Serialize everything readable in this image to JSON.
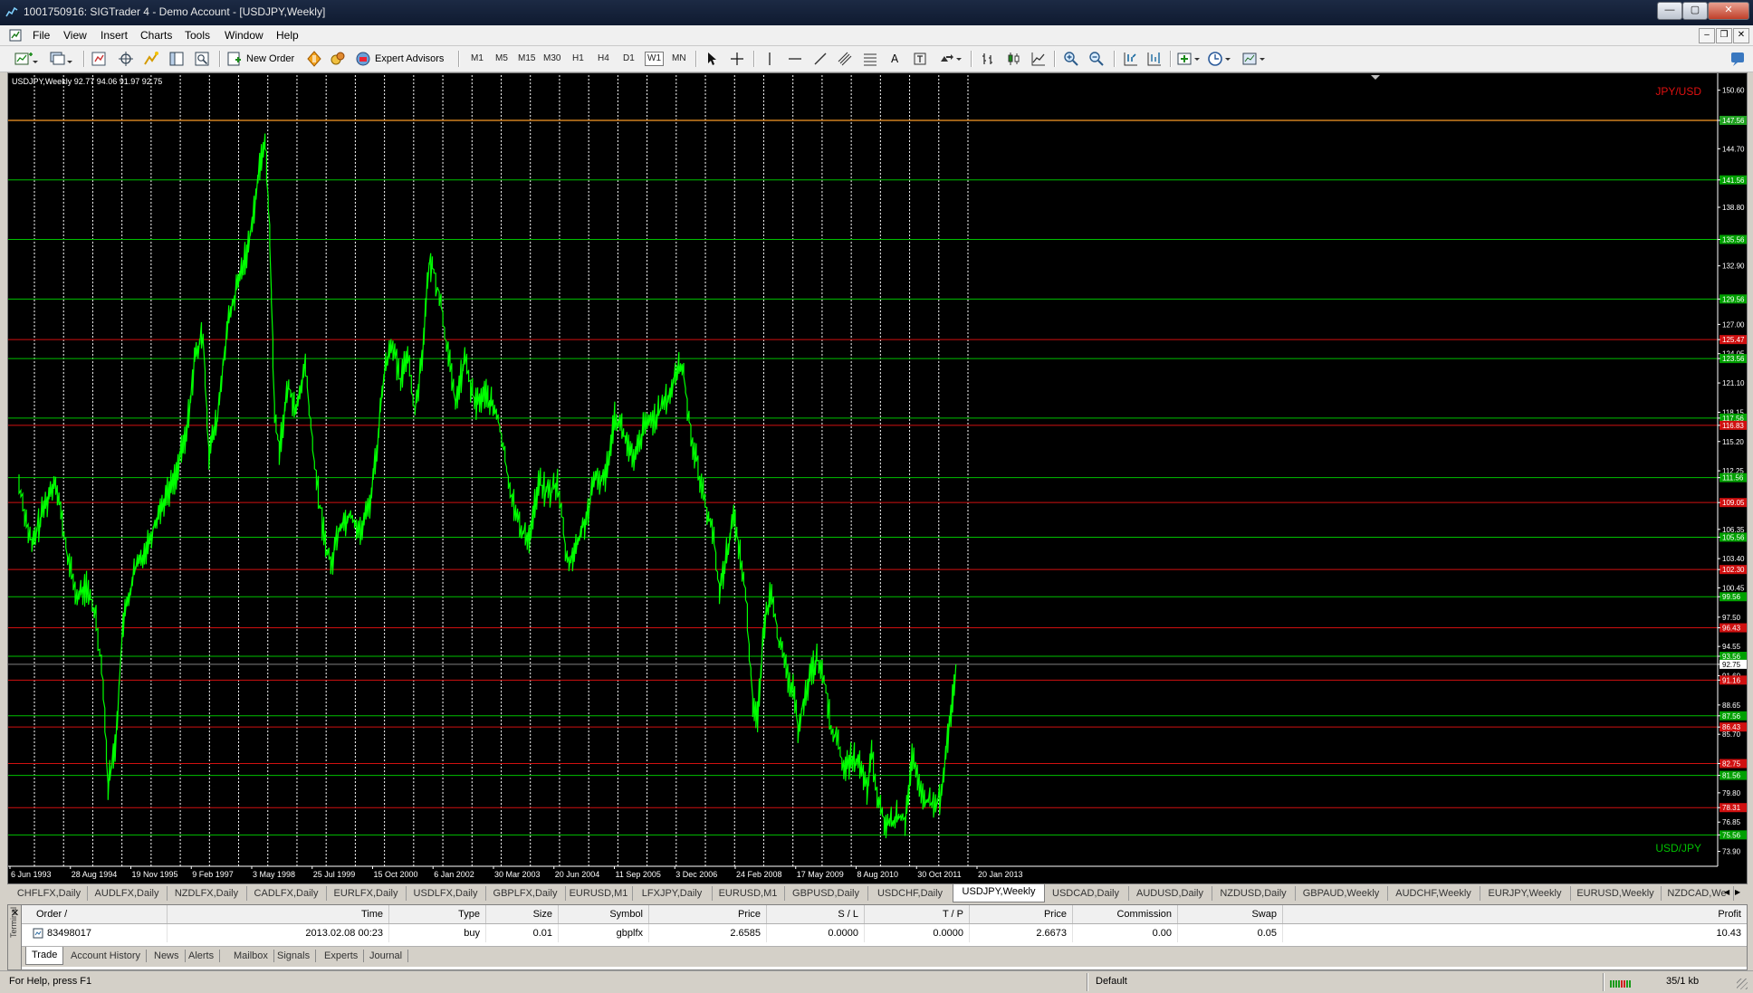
{
  "window": {
    "title": "1001750916: SIGTrader 4 - Demo Account - [USDJPY,Weekly]"
  },
  "menu": {
    "items": [
      "File",
      "View",
      "Insert",
      "Charts",
      "Tools",
      "Window",
      "Help"
    ]
  },
  "toolbar": {
    "new_order_label": "New Order",
    "expert_advisors_label": "Expert Advisors",
    "timeframes": [
      "M1",
      "M5",
      "M15",
      "M30",
      "H1",
      "H4",
      "D1",
      "W1",
      "MN"
    ]
  },
  "chart": {
    "header_label": "USDJPY,Weekly  92.77 94.06 91.97 92.75",
    "label_top_right": "JPY/USD",
    "label_bottom_right": "USD/JPY",
    "colors": {
      "background": "#000000",
      "price_line": "#00ff00",
      "grid": "#ffffff",
      "support_line": "#00c000",
      "resistance_line": "#d01010",
      "top_line": "#d08020"
    }
  },
  "chart_data": {
    "type": "line",
    "series_color": "#00ff00",
    "ylim": [
      72.4,
      152.3
    ],
    "y_ticks": [
      "150.60",
      "147.56",
      "144.70",
      "141.56",
      "138.80",
      "135.56",
      "132.90",
      "129.56",
      "127.00",
      "125.47",
      "124.05",
      "123.56",
      "121.10",
      "118.15",
      "117.56",
      "116.83",
      "115.20",
      "112.25",
      "111.56",
      "109.05",
      "106.35",
      "105.56",
      "103.40",
      "102.30",
      "100.45",
      "99.56",
      "97.50",
      "96.43",
      "94.55",
      "93.56",
      "92.75",
      "91.60",
      "91.16",
      "88.65",
      "87.56",
      "86.43",
      "85.70",
      "82.75",
      "81.56",
      "79.80",
      "78.31",
      "76.85",
      "75.56",
      "73.90"
    ],
    "x_ticks": [
      "6 Jun 1993",
      "28 Aug 1994",
      "19 Nov 1995",
      "9 Feb 1997",
      "3 May 1998",
      "25 Jul 1999",
      "15 Oct 2000",
      "6 Jan 2002",
      "30 Mar 2003",
      "20 Jun 2004",
      "11 Sep 2005",
      "3 Dec 2006",
      "24 Feb 2008",
      "17 May 2009",
      "8 Aug 2010",
      "30 Oct 2011",
      "20 Jan 2013"
    ],
    "green_levels": [
      141.56,
      135.56,
      129.56,
      123.56,
      117.56,
      111.56,
      105.56,
      99.56,
      93.56,
      87.56,
      81.56,
      75.56
    ],
    "red_levels": [
      125.47,
      116.83,
      109.05,
      102.3,
      96.43,
      91.16,
      86.43,
      82.75,
      78.31
    ],
    "orange_levels": [
      147.56
    ],
    "current_price": 92.75,
    "price_points": [
      [
        1993.43,
        111.0
      ],
      [
        1993.7,
        104.5
      ],
      [
        1993.95,
        108.5
      ],
      [
        1994.2,
        111.5
      ],
      [
        1994.45,
        103.5
      ],
      [
        1994.65,
        99.5
      ],
      [
        1994.85,
        100.5
      ],
      [
        1995.05,
        97.5
      ],
      [
        1995.2,
        91.0
      ],
      [
        1995.3,
        80.5
      ],
      [
        1995.45,
        84.5
      ],
      [
        1995.62,
        97.0
      ],
      [
        1995.85,
        102.0
      ],
      [
        1996.1,
        104.5
      ],
      [
        1996.4,
        108.5
      ],
      [
        1996.7,
        111.5
      ],
      [
        1996.95,
        116.0
      ],
      [
        1997.12,
        123.5
      ],
      [
        1997.3,
        126.0
      ],
      [
        1997.42,
        114.0
      ],
      [
        1997.6,
        117.5
      ],
      [
        1997.8,
        126.5
      ],
      [
        1998.0,
        130.5
      ],
      [
        1998.25,
        135.0
      ],
      [
        1998.45,
        141.5
      ],
      [
        1998.6,
        146.0
      ],
      [
        1998.7,
        136.0
      ],
      [
        1998.8,
        118.0
      ],
      [
        1998.9,
        114.5
      ],
      [
        1999.1,
        121.0
      ],
      [
        1999.25,
        118.0
      ],
      [
        1999.45,
        123.0
      ],
      [
        1999.6,
        114.5
      ],
      [
        1999.8,
        107.0
      ],
      [
        1999.98,
        102.5
      ],
      [
        2000.15,
        106.5
      ],
      [
        2000.4,
        108.0
      ],
      [
        2000.6,
        106.0
      ],
      [
        2000.8,
        109.0
      ],
      [
        2000.95,
        114.5
      ],
      [
        2001.1,
        122.0
      ],
      [
        2001.25,
        125.5
      ],
      [
        2001.45,
        121.0
      ],
      [
        2001.6,
        124.5
      ],
      [
        2001.75,
        118.0
      ],
      [
        2001.9,
        124.0
      ],
      [
        2002.05,
        133.0
      ],
      [
        2002.15,
        132.5
      ],
      [
        2002.3,
        129.0
      ],
      [
        2002.45,
        124.0
      ],
      [
        2002.6,
        119.0
      ],
      [
        2002.8,
        123.5
      ],
      [
        2003.0,
        119.0
      ],
      [
        2003.25,
        120.0
      ],
      [
        2003.5,
        117.5
      ],
      [
        2003.75,
        110.5
      ],
      [
        2003.95,
        106.5
      ],
      [
        2004.15,
        105.5
      ],
      [
        2004.35,
        111.0
      ],
      [
        2004.55,
        110.0
      ],
      [
        2004.75,
        111.0
      ],
      [
        2004.95,
        103.0
      ],
      [
        2005.1,
        104.0
      ],
      [
        2005.35,
        107.5
      ],
      [
        2005.55,
        111.5
      ],
      [
        2005.75,
        111.5
      ],
      [
        2005.95,
        118.0
      ],
      [
        2006.1,
        116.5
      ],
      [
        2006.35,
        113.0
      ],
      [
        2006.55,
        116.5
      ],
      [
        2006.75,
        117.5
      ],
      [
        2006.95,
        118.5
      ],
      [
        2007.15,
        120.5
      ],
      [
        2007.3,
        123.0
      ],
      [
        2007.4,
        122.0
      ],
      [
        2007.55,
        116.0
      ],
      [
        2007.7,
        112.5
      ],
      [
        2007.85,
        109.0
      ],
      [
        2008.0,
        106.5
      ],
      [
        2008.15,
        100.0
      ],
      [
        2008.3,
        104.0
      ],
      [
        2008.45,
        107.5
      ],
      [
        2008.55,
        105.0
      ],
      [
        2008.7,
        100.0
      ],
      [
        2008.85,
        89.0
      ],
      [
        2008.95,
        87.5
      ],
      [
        2009.1,
        97.0
      ],
      [
        2009.25,
        100.5
      ],
      [
        2009.4,
        95.0
      ],
      [
        2009.55,
        92.0
      ],
      [
        2009.7,
        90.0
      ],
      [
        2009.8,
        86.5
      ],
      [
        2009.92,
        89.0
      ],
      [
        2010.05,
        91.5
      ],
      [
        2010.2,
        93.5
      ],
      [
        2010.35,
        91.0
      ],
      [
        2010.5,
        86.5
      ],
      [
        2010.65,
        84.5
      ],
      [
        2010.8,
        82.0
      ],
      [
        2010.95,
        83.5
      ],
      [
        2011.1,
        82.5
      ],
      [
        2011.25,
        80.0
      ],
      [
        2011.35,
        83.5
      ],
      [
        2011.5,
        78.5
      ],
      [
        2011.65,
        76.5
      ],
      [
        2011.8,
        77.0
      ],
      [
        2011.92,
        77.5
      ],
      [
        2012.05,
        77.0
      ],
      [
        2012.2,
        83.5
      ],
      [
        2012.35,
        80.0
      ],
      [
        2012.5,
        79.0
      ],
      [
        2012.65,
        78.5
      ],
      [
        2012.82,
        79.5
      ],
      [
        2012.95,
        85.5
      ],
      [
        2013.05,
        89.0
      ],
      [
        2013.12,
        92.75
      ]
    ]
  },
  "symbol_tabs": {
    "items": [
      "CHFLFX,Daily",
      "AUDLFX,Daily",
      "NZDLFX,Daily",
      "CADLFX,Daily",
      "EURLFX,Daily",
      "USDLFX,Daily",
      "GBPLFX,Daily",
      "EURUSD,M1",
      "LFXJPY,Daily",
      "EURUSD,M1",
      "GBPUSD,Daily",
      "USDCHF,Daily",
      "USDJPY,Weekly",
      "USDCAD,Daily",
      "AUDUSD,Daily",
      "NZDUSD,Daily",
      "GBPAUD,Weekly",
      "AUDCHF,Weekly",
      "EURJPY,Weekly",
      "EURUSD,Weekly",
      "NZDCAD,We"
    ],
    "active_index": 12
  },
  "terminal": {
    "side_label": "Terminal",
    "columns": [
      "Order",
      "Time",
      "Type",
      "Size",
      "Symbol",
      "Price",
      "S / L",
      "T / P",
      "Price",
      "Commission",
      "Swap",
      "Profit"
    ],
    "rows": [
      [
        "83498017",
        "2013.02.08 00:23",
        "buy",
        "0.01",
        "gbplfx",
        "2.6585",
        "0.0000",
        "0.0000",
        "2.6673",
        "0.00",
        "0.05",
        "10.43"
      ]
    ],
    "tabs": [
      "Trade",
      "Account History",
      "News",
      "Alerts",
      "Mailbox",
      "Signals",
      "Experts",
      "Journal"
    ],
    "active_tab": 0
  },
  "statusbar": {
    "help_text": "For Help, press F1",
    "profile": "Default",
    "connection": "35/1 kb"
  }
}
